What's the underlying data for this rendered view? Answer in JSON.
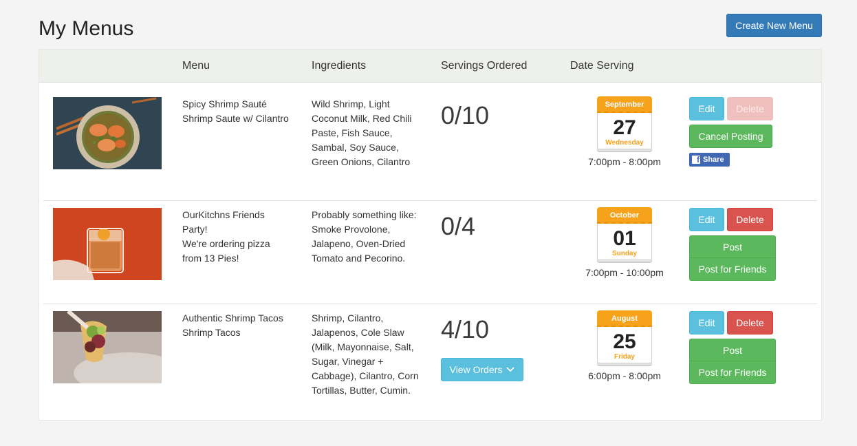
{
  "page": {
    "title": "My Menus"
  },
  "toolbar": {
    "create_label": "Create New Menu"
  },
  "table": {
    "headers": {
      "menu": "Menu",
      "ingredients": "Ingredients",
      "servings": "Servings Ordered",
      "date": "Date Serving"
    }
  },
  "rows": [
    {
      "menu_lines": [
        "Spicy Shrimp Sauté",
        "Shrimp Saute w/ Cilantro"
      ],
      "ingredient_lines": [
        "Wild Shrimp, Light",
        "Coconut Milk, Red Chili",
        "Paste, Fish Sauce,",
        "Sambal, Soy Sauce,",
        "Green Onions, Cilantro"
      ],
      "servings": "0/10",
      "calendar": {
        "month": "September",
        "day": "27",
        "weekday": "Wednesday"
      },
      "time": "7:00pm - 8:00pm",
      "actions": {
        "edit": "Edit",
        "delete": "Delete",
        "cancel": "Cancel Posting",
        "share": "Share"
      }
    },
    {
      "menu_lines": [
        "OurKitchns Friends",
        "Party!",
        "We're ordering pizza",
        "from 13 Pies!"
      ],
      "ingredient_lines": [
        "Probably something like:",
        "Smoke Provolone,",
        "Jalapeno, Oven-Dried",
        "Tomato and Pecorino."
      ],
      "servings": "0/4",
      "calendar": {
        "month": "October",
        "day": "01",
        "weekday": "Sunday"
      },
      "time": "7:00pm - 10:00pm",
      "actions": {
        "edit": "Edit",
        "delete": "Delete",
        "post": "Post",
        "post_friends": "Post for Friends"
      }
    },
    {
      "menu_lines": [
        "Authentic Shrimp Tacos",
        "Shrimp Tacos"
      ],
      "ingredient_lines": [
        "Shrimp, Cilantro,",
        "Jalapenos, Cole Slaw",
        "(Milk, Mayonnaise, Salt,",
        "Sugar, Vinegar +",
        "Cabbage), Cilantro, Corn",
        "Tortillas, Butter, Cumin."
      ],
      "servings": "4/10",
      "view_orders": "View Orders",
      "calendar": {
        "month": "August",
        "day": "25",
        "weekday": "Friday"
      },
      "time": "6:00pm - 8:00pm",
      "actions": {
        "edit": "Edit",
        "delete": "Delete",
        "post": "Post",
        "post_friends": "Post for Friends"
      }
    }
  ],
  "colors": {
    "primary": "#337ab7",
    "info": "#5bc0de",
    "danger": "#d9534f",
    "success": "#5cb85c",
    "calendar_accent": "#f7a21b",
    "facebook": "#4267b2"
  },
  "icons": {
    "view_orders": "chevron-down-icon",
    "share": "facebook-icon"
  }
}
